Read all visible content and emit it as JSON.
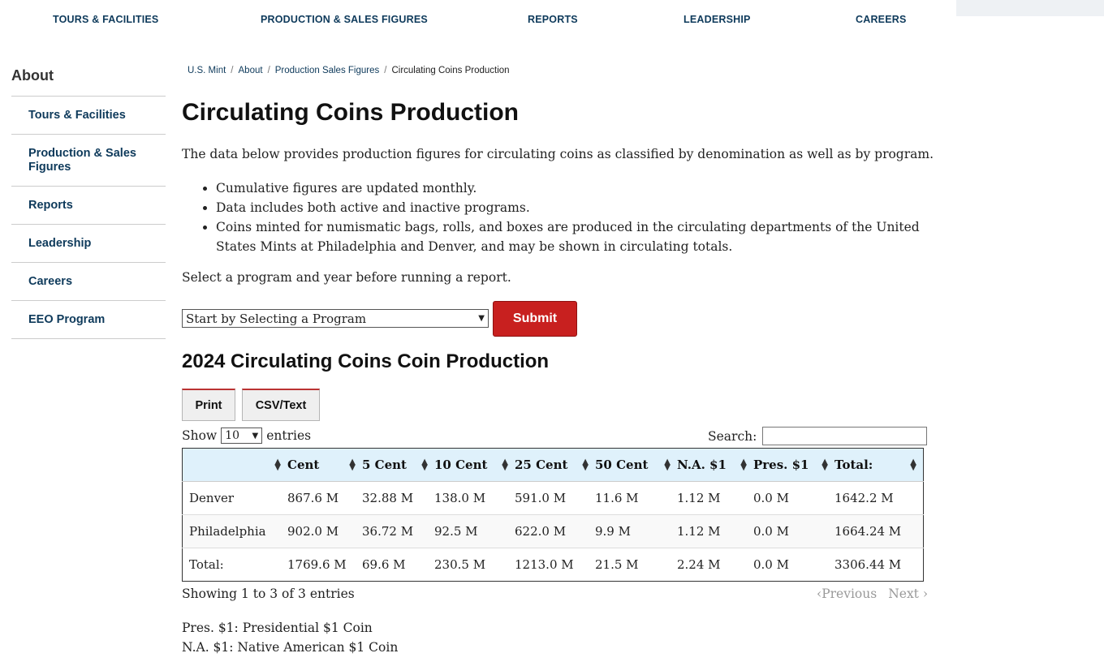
{
  "topnav": {
    "items": [
      "TOURS & FACILITIES",
      "PRODUCTION & SALES FIGURES",
      "REPORTS",
      "LEADERSHIP",
      "CAREERS"
    ]
  },
  "sidebar": {
    "title": "About",
    "items": [
      "Tours & Facilities",
      "Production & Sales Figures",
      "Reports",
      "Leadership",
      "Careers",
      "EEO Program"
    ]
  },
  "breadcrumb": [
    "U.S. Mint",
    "About",
    "Production Sales Figures",
    "Circulating Coins Production"
  ],
  "page": {
    "title": "Circulating Coins Production",
    "intro": "The data below provides production figures for circulating coins as classified by denomination as well as by program.",
    "bullets": [
      "Cumulative figures are updated monthly.",
      "Data includes both active and inactive programs.",
      "Coins minted for numismatic bags, rolls, and boxes are produced in the circulating departments of the United States Mints at Philadelphia and Denver, and may be shown in circulating totals."
    ],
    "select_message": "Select a program and year before running a report.",
    "program_select": "Start by Selecting a Program",
    "submit_label": "Submit",
    "report_title": "2024 Circulating Coins Coin Production",
    "print_label": "Print",
    "csv_label": "CSV/Text",
    "show_label": "Show",
    "show_value": "10",
    "entries_label": "entries",
    "search_label": "Search:",
    "info": "Showing 1 to 3 of 3 entries",
    "previous": "Previous",
    "next": "Next",
    "notes": [
      "Pres. $1: Presidential $1 Coin",
      "N.A. $1: Native American $1 Coin"
    ]
  },
  "table": {
    "headers": [
      "",
      "Cent",
      "5 Cent",
      "10 Cent",
      "25 Cent",
      "50 Cent",
      "N.A. $1",
      "Pres. $1",
      "Total:"
    ],
    "rows": [
      [
        "Denver",
        "867.6 M",
        "32.88 M",
        "138.0 M",
        "591.0 M",
        "11.6 M",
        "1.12 M",
        "0.0 M",
        "1642.2 M"
      ],
      [
        "Philadelphia",
        "902.0 M",
        "36.72 M",
        "92.5 M",
        "622.0 M",
        "9.9 M",
        "1.12 M",
        "0.0 M",
        "1664.24 M"
      ],
      [
        "Total:",
        "1769.6 M",
        "69.6 M",
        "230.5 M",
        "1213.0 M",
        "21.5 M",
        "2.24 M",
        "0.0 M",
        "3306.44 M"
      ]
    ]
  }
}
